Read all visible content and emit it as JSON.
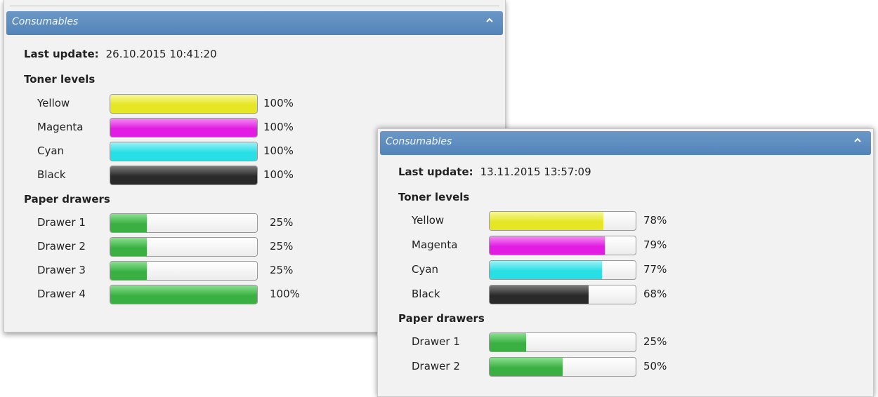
{
  "panels": [
    {
      "title": "Consumables",
      "last_update_label": "Last update:",
      "last_update": "26.10.2015 10:41:20",
      "toner_heading": "Toner levels",
      "toners": [
        {
          "name": "Yellow",
          "percent": "100%",
          "level": 1.0,
          "color": "#e6e625",
          "hi": "#f7f79a"
        },
        {
          "name": "Magenta",
          "percent": "100%",
          "level": 1.0,
          "color": "#e21ce2",
          "hi": "#f48cf4"
        },
        {
          "name": "Cyan",
          "percent": "100%",
          "level": 1.0,
          "color": "#28dfe6",
          "hi": "#9cf1f4"
        },
        {
          "name": "Black",
          "percent": "100%",
          "level": 1.0,
          "color": "#2a2a2a",
          "hi": "#7a7a7a"
        }
      ],
      "paper_heading": "Paper drawers",
      "drawers": [
        {
          "name": "Drawer 1",
          "percent": "25%",
          "level": 0.25,
          "color": "#3ab043",
          "hi": "#8be08f"
        },
        {
          "name": "Drawer 2",
          "percent": "25%",
          "level": 0.25,
          "color": "#3ab043",
          "hi": "#8be08f"
        },
        {
          "name": "Drawer 3",
          "percent": "25%",
          "level": 0.25,
          "color": "#3ab043",
          "hi": "#8be08f"
        },
        {
          "name": "Drawer 4",
          "percent": "100%",
          "level": 1.0,
          "color": "#3ab043",
          "hi": "#8be08f"
        }
      ]
    },
    {
      "title": "Consumables",
      "last_update_label": "Last update:",
      "last_update": "13.11.2015 13:57:09",
      "toner_heading": "Toner levels",
      "toners": [
        {
          "name": "Yellow",
          "percent": "78%",
          "level": 0.78,
          "color": "#e6e625",
          "hi": "#f7f79a"
        },
        {
          "name": "Magenta",
          "percent": "79%",
          "level": 0.79,
          "color": "#e21ce2",
          "hi": "#f48cf4"
        },
        {
          "name": "Cyan",
          "percent": "77%",
          "level": 0.77,
          "color": "#28dfe6",
          "hi": "#9cf1f4"
        },
        {
          "name": "Black",
          "percent": "68%",
          "level": 0.68,
          "color": "#2a2a2a",
          "hi": "#7a7a7a"
        }
      ],
      "paper_heading": "Paper drawers",
      "drawers": [
        {
          "name": "Drawer 1",
          "percent": "25%",
          "level": 0.25,
          "color": "#3ab043",
          "hi": "#8be08f"
        },
        {
          "name": "Drawer 2",
          "percent": "50%",
          "level": 0.5,
          "color": "#3ab043",
          "hi": "#8be08f"
        }
      ]
    }
  ]
}
